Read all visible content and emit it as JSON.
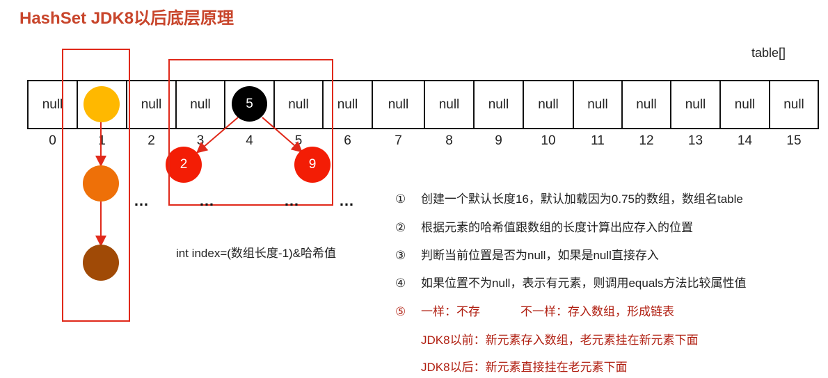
{
  "title": "HashSet JDK8以后底层原理",
  "table_label": "table[]",
  "cells": [
    "null",
    "",
    "null",
    "null",
    "5",
    "null",
    "null",
    "null",
    "null",
    "null",
    "null",
    "null",
    "null",
    "null",
    "null",
    "null"
  ],
  "indices": [
    "0",
    "1",
    "2",
    "3",
    "4",
    "5",
    "6",
    "7",
    "8",
    "9",
    "10",
    "11",
    "12",
    "13",
    "14",
    "15"
  ],
  "chain_colors": [
    "#ffb800",
    "#ee7008",
    "#a04a06"
  ],
  "tree_nodes": {
    "root": "5",
    "left": "2",
    "right": "9"
  },
  "ellipsis": "…",
  "formula": "int index=(数组长度-1)&哈希值",
  "steps": [
    {
      "num": "①",
      "text": "创建一个默认长度16，默认加载因为0.75的数组，数组名table"
    },
    {
      "num": "②",
      "text": "根据元素的哈希值跟数组的长度计算出应存入的位置"
    },
    {
      "num": "③",
      "text": "判断当前位置是否为null，如果是null直接存入"
    },
    {
      "num": "④",
      "text": "如果位置不为null，表示有元素，则调用equals方法比较属性值"
    },
    {
      "num": "⑤",
      "text": "一样：不存",
      "text2": "不一样：存入数组，形成链表"
    }
  ],
  "notes": [
    "JDK8以前：新元素存入数组，老元素挂在新元素下面",
    "JDK8以后：新元素直接挂在老元素下面"
  ]
}
